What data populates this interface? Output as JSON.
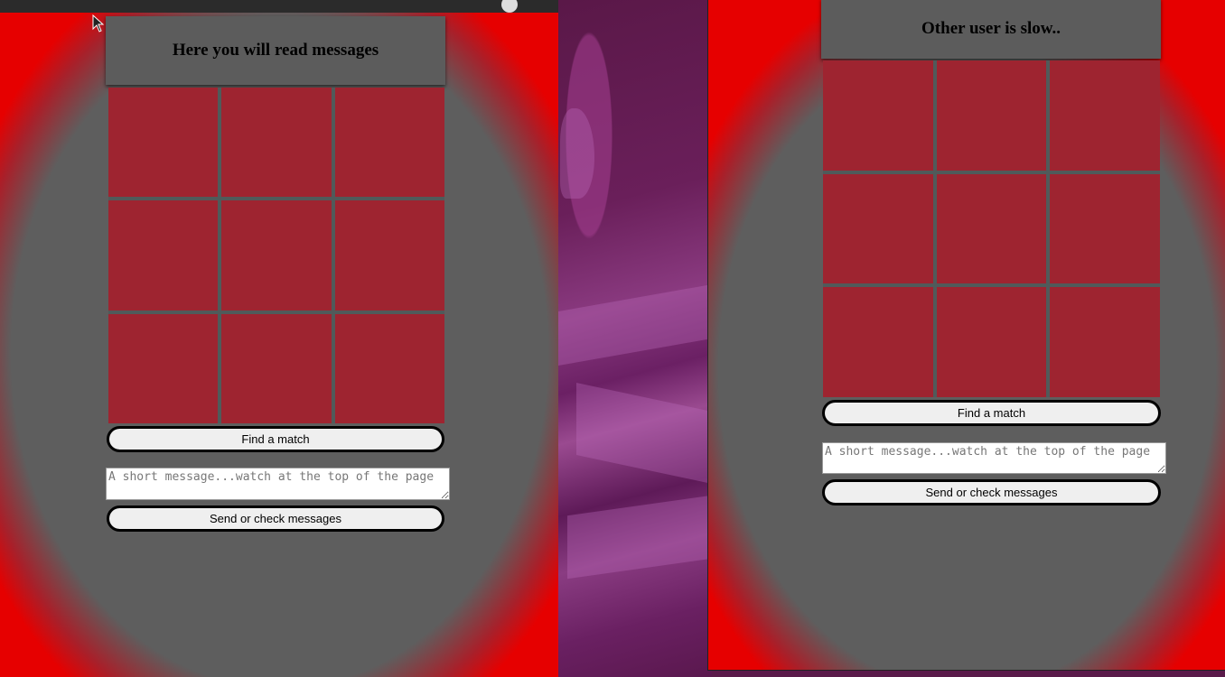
{
  "left_window": {
    "header_text": "Here you will read messages",
    "find_match_label": "Find a match",
    "message_placeholder": "A short message...watch at the top of the page",
    "send_label": "Send or check messages",
    "board": [
      "",
      "",
      "",
      "",
      "",
      "",
      "",
      "",
      ""
    ]
  },
  "right_window": {
    "header_text": "Other user is slow..",
    "find_match_label": "Find a match",
    "message_placeholder": "A short message...watch at the top of the page",
    "send_label": "Send or check messages",
    "board": [
      "",
      "",
      "",
      "",
      "",
      "",
      "",
      "",
      ""
    ]
  },
  "colors": {
    "cell": "#9e2430",
    "grid_line": "#505a5a",
    "panel": "#5c5c5c",
    "edge_red": "#e60000"
  }
}
